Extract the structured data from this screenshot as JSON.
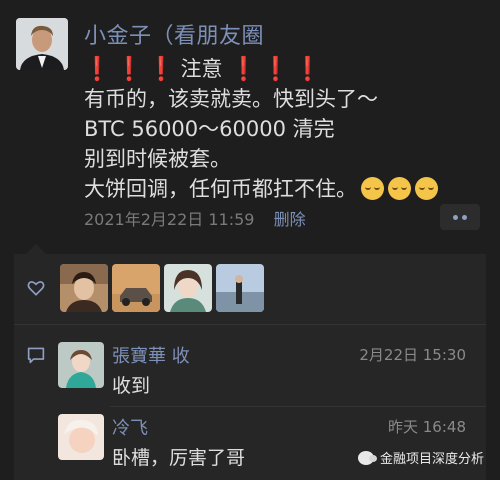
{
  "post": {
    "author": "小金子（看朋友圈",
    "warning_marks": [
      "❗",
      "❗",
      "❗",
      "❗",
      "❗",
      "❗"
    ],
    "warning_word": "注意",
    "lines": [
      "有币的，该卖就卖。快到头了～",
      "BTC 56000～60000 清完",
      "别到时候被套。",
      "大饼回调，任何币都扛不住。"
    ],
    "timestamp": "2021年2月22日 11:59",
    "delete_label": "删除"
  },
  "likes": {
    "icon": "heart-outline-icon",
    "users": [
      "liker-1",
      "liker-2",
      "liker-3",
      "liker-4"
    ]
  },
  "comments": [
    {
      "name": "張寶華 收",
      "time": "2月22日 15:30",
      "text": "收到"
    },
    {
      "name": "冷飞",
      "time": "昨天 16:48",
      "text": "卧槽，厉害了哥"
    }
  ],
  "watermark": {
    "text": "金融项目深度分析"
  },
  "colors": {
    "background": "#1e1e1e",
    "name_blue": "#7d90b8",
    "warning_red": "#e33a2e"
  }
}
